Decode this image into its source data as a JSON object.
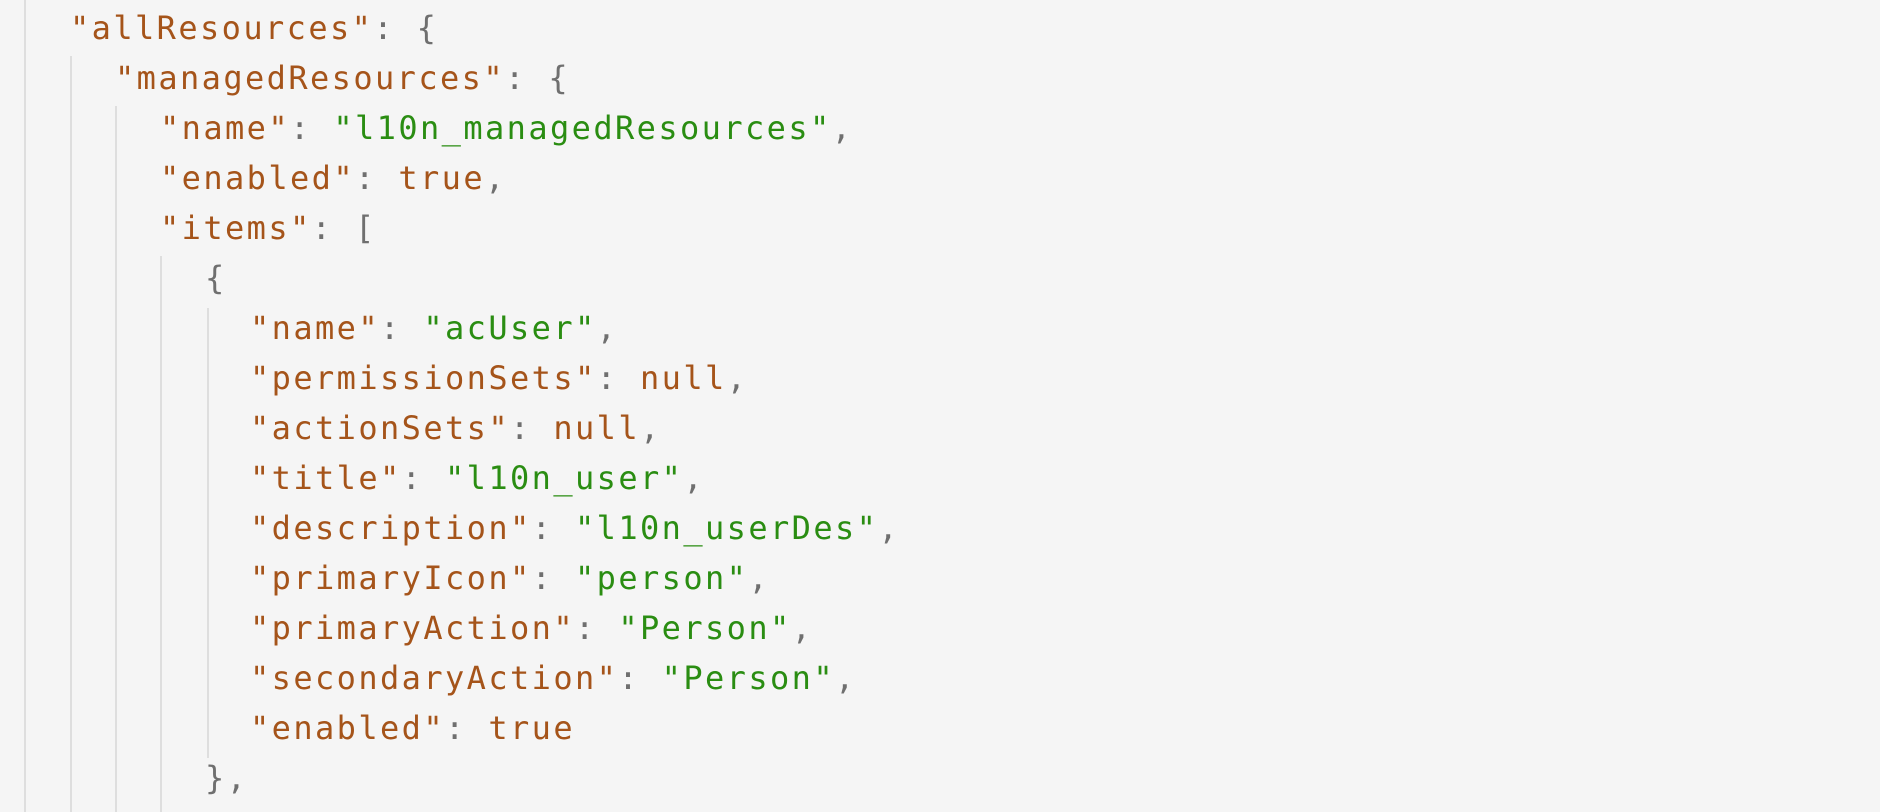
{
  "code": {
    "lines": [
      {
        "indent": 1,
        "key": "allResources",
        "sep": ": ",
        "open": "{"
      },
      {
        "indent": 2,
        "key": "managedResources",
        "sep": ": ",
        "open": "{"
      },
      {
        "indent": 3,
        "key": "name",
        "sep": ": ",
        "str": "l10n_managedResources",
        "trail": ","
      },
      {
        "indent": 3,
        "key": "enabled",
        "sep": ": ",
        "lit": "true",
        "trail": ","
      },
      {
        "indent": 3,
        "key": "items",
        "sep": ": ",
        "open": "["
      },
      {
        "indent": 4,
        "open": "{"
      },
      {
        "indent": 5,
        "key": "name",
        "sep": ": ",
        "str": "acUser",
        "trail": ","
      },
      {
        "indent": 5,
        "key": "permissionSets",
        "sep": ": ",
        "lit": "null",
        "trail": ","
      },
      {
        "indent": 5,
        "key": "actionSets",
        "sep": ": ",
        "lit": "null",
        "trail": ","
      },
      {
        "indent": 5,
        "key": "title",
        "sep": ": ",
        "str": "l10n_user",
        "trail": ","
      },
      {
        "indent": 5,
        "key": "description",
        "sep": ": ",
        "str": "l10n_userDes",
        "trail": ","
      },
      {
        "indent": 5,
        "key": "primaryIcon",
        "sep": ": ",
        "str": "person",
        "trail": ","
      },
      {
        "indent": 5,
        "key": "primaryAction",
        "sep": ": ",
        "str": "Person",
        "trail": ","
      },
      {
        "indent": 5,
        "key": "secondaryAction",
        "sep": ": ",
        "str": "Person",
        "trail": ","
      },
      {
        "indent": 5,
        "key": "enabled",
        "sep": ": ",
        "lit": "true"
      },
      {
        "indent": 4,
        "close": "}",
        "trail": ","
      }
    ]
  },
  "colors": {
    "background": "#f5f5f5",
    "key": "#a5541a",
    "string": "#2a8d12",
    "punctuation": "#6f6f6f",
    "indent_guide": "#dedede"
  }
}
